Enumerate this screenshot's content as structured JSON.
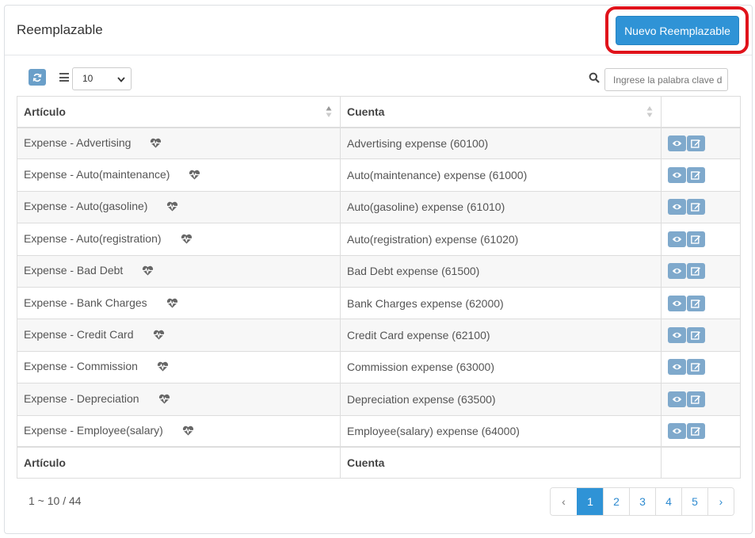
{
  "header": {
    "title": "Reemplazable",
    "new_button_label": "Nuevo Reemplazable"
  },
  "toolbar": {
    "page_size": "10",
    "search_placeholder": "Ingrese la palabra clave d"
  },
  "table": {
    "columns": [
      "Artículo",
      "Cuenta",
      ""
    ],
    "rows": [
      {
        "articulo": "Expense - Advertising",
        "cuenta": "Advertising expense (60100)"
      },
      {
        "articulo": "Expense - Auto(maintenance)",
        "cuenta": "Auto(maintenance) expense (61000)"
      },
      {
        "articulo": "Expense - Auto(gasoline)",
        "cuenta": "Auto(gasoline) expense (61010)"
      },
      {
        "articulo": "Expense - Auto(registration)",
        "cuenta": "Auto(registration) expense (61020)"
      },
      {
        "articulo": "Expense - Bad Debt",
        "cuenta": "Bad Debt expense (61500)"
      },
      {
        "articulo": "Expense - Bank Charges",
        "cuenta": "Bank Charges expense (62000)"
      },
      {
        "articulo": "Expense - Credit Card",
        "cuenta": "Credit Card expense (62100)"
      },
      {
        "articulo": "Expense - Commission",
        "cuenta": "Commission expense (63000)"
      },
      {
        "articulo": "Expense - Depreciation",
        "cuenta": "Depreciation expense (63500)"
      },
      {
        "articulo": "Expense - Employee(salary)",
        "cuenta": "Employee(salary) expense (64000)"
      }
    ],
    "footer": [
      "Artículo",
      "Cuenta"
    ]
  },
  "pagination": {
    "summary": "1 ~ 10 / 44",
    "prev": "‹",
    "pages": [
      "1",
      "2",
      "3",
      "4",
      "5"
    ],
    "next": "›",
    "active_page": "1"
  },
  "icons": {
    "refresh": "refresh-icon",
    "list": "list-icon",
    "search": "search-icon",
    "heart": "heartbeat-icon",
    "view": "eye-icon",
    "edit": "edit-icon"
  },
  "colors": {
    "primary": "#2f93d6",
    "highlight": "#e0131b",
    "action_button": "#7fa9cc"
  }
}
